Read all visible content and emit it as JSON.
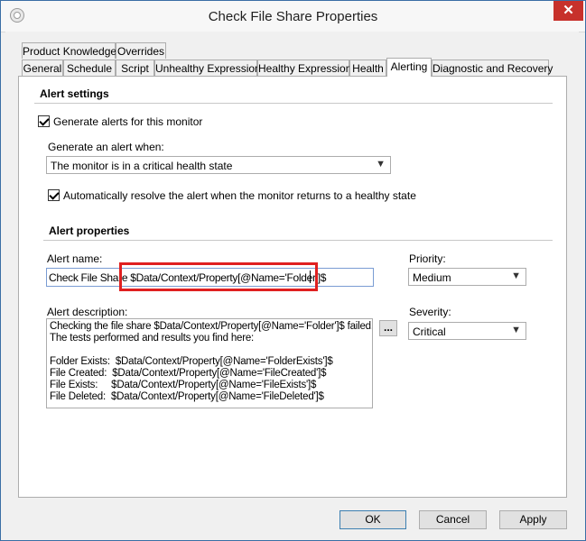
{
  "window": {
    "title": "Check File Share Properties",
    "close_glyph": "✕"
  },
  "tabs_row1": [
    "Product Knowledge",
    "Overrides"
  ],
  "tabs_row2": [
    "General",
    "Schedule",
    "Script",
    "Unhealthy Expression",
    "Healthy Expression",
    "Health",
    "Alerting",
    "Diagnostic and Recovery"
  ],
  "active_tab": "Alerting",
  "alert_settings": {
    "title": "Alert settings",
    "generate_alerts_label": "Generate alerts for this monitor",
    "generate_alerts_checked": true,
    "generate_when_label": "Generate an alert when:",
    "generate_when_value": "The monitor is in a critical health state",
    "auto_resolve_label": "Automatically resolve the alert when the monitor returns to a healthy state",
    "auto_resolve_checked": true
  },
  "alert_properties": {
    "title": "Alert properties",
    "name_label": "Alert name:",
    "name_value": "Check File Share $Data/Context/Property[@Name='Folder']$",
    "priority_label": "Priority:",
    "priority_value": "Medium",
    "description_label": "Alert description:",
    "description_lines": [
      "Checking the file share $Data/Context/Property[@Name='Folder']$ failed.",
      "The tests performed and results you find here:",
      "",
      "Folder Exists:  $Data/Context/Property[@Name='FolderExists']$",
      "File Created:  $Data/Context/Property[@Name='FileCreated']$",
      "File Exists:     $Data/Context/Property[@Name='FileExists']$",
      "File Deleted:  $Data/Context/Property[@Name='FileDeleted']$"
    ],
    "ellipsis_label": "...",
    "severity_label": "Severity:",
    "severity_value": "Critical"
  },
  "buttons": {
    "ok": "OK",
    "cancel": "Cancel",
    "apply": "Apply"
  },
  "colors": {
    "highlight": "#e02020",
    "close": "#c7312b"
  },
  "icons": {
    "dropdown": "▼"
  }
}
